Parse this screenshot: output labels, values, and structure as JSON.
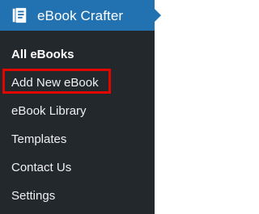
{
  "header": {
    "icon": "book-document-icon",
    "title": "eBook Crafter"
  },
  "menu": {
    "items": [
      {
        "label": "All eBooks",
        "active": true
      },
      {
        "label": "Add New eBook",
        "highlighted": true,
        "highlight_color": "#e10600"
      },
      {
        "label": "eBook Library"
      },
      {
        "label": "Templates"
      },
      {
        "label": "Contact Us"
      },
      {
        "label": "Settings"
      }
    ]
  },
  "colors": {
    "panel_bg": "#23282d",
    "header_bg": "#2271b1",
    "text": "#f0f0f1",
    "highlight": "#e10600"
  }
}
